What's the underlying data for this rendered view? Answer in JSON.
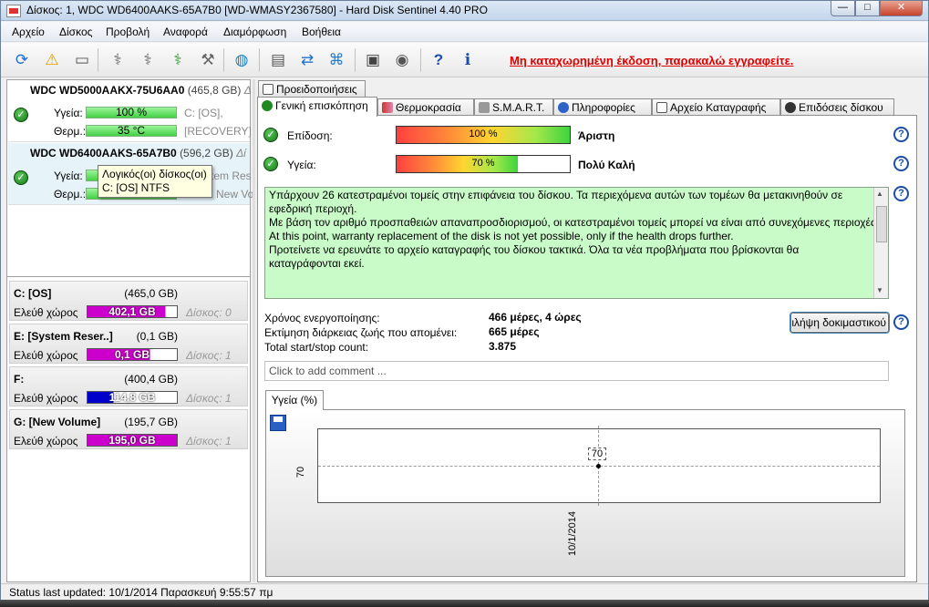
{
  "window": {
    "title": "Δίσκος: 1, WDC WD6400AAKS-65A7B0 [WD-WMASY2367580]  -  Hard Disk Sentinel 4.40 PRO",
    "min": "—",
    "max": "□",
    "close": "✕"
  },
  "menu": [
    "Αρχείο",
    "Δίσκος",
    "Προβολή",
    "Αναφορά",
    "Διαμόρφωση",
    "Βοήθεια"
  ],
  "toolbar": {
    "registration_notice": "Μη καταχωρημένη έκδοση, παρακαλώ εγγραφείτε."
  },
  "disks": [
    {
      "name": "WDC WD5000AAKX-75U6AA0",
      "size": "(465,8 GB)",
      "extra": "Δ",
      "health_label": "Υγεία:",
      "health_value": "100 %",
      "health_part": "C: [OS],",
      "temp_label": "Θερμ.:",
      "temp_value": "35 °C",
      "temp_part": "[RECOVERY]"
    },
    {
      "name": "WDC WD6400AAKS-65A7B0",
      "size": "(596,2 GB)",
      "extra": "Δί",
      "health_label": "Υγεία:",
      "health_value": "",
      "health_part": "tem Res",
      "temp_label": "Θερμ.:",
      "temp_value": "",
      "temp_part": "New Vo"
    }
  ],
  "tooltip": {
    "line1": "Λογικός(οι) δίσκος(οι)",
    "line2": "C: [OS] NTFS"
  },
  "volumes": [
    {
      "name": "C: [OS]",
      "size": "(465,0 GB)",
      "free_label": "Ελεύθ χώρος",
      "free": "402,1 GB",
      "free_fraction": 0.865,
      "disk": "Δίσκος: 0",
      "color": "#cc00cc"
    },
    {
      "name": "E: [System Reser..]",
      "size": "(0,1 GB)",
      "free_label": "Ελεύθ χώρος",
      "free": "0,1 GB",
      "free_fraction": 0.7,
      "disk": "Δίσκος: 1",
      "color": "#cc00cc"
    },
    {
      "name": "F:",
      "size": "(400,4 GB)",
      "free_label": "Ελεύθ χώρος",
      "free": "114,8 GB",
      "free_fraction": 0.287,
      "disk": "Δίσκος: 1",
      "color": "#0000cc"
    },
    {
      "name": "G: [New Volume]",
      "size": "(195,7 GB)",
      "free_label": "Ελεύθ χώρος",
      "free": "195,0 GB",
      "free_fraction": 0.996,
      "disk": "Δίσκος: 1",
      "color": "#cc00cc"
    }
  ],
  "tabs_row1": [
    {
      "label": "Προειδοποιήσεις"
    }
  ],
  "tabs_row2": [
    {
      "label": "Γενική επισκόπηση"
    },
    {
      "label": "Θερμοκρασία"
    },
    {
      "label": "S.M.A.R.T."
    },
    {
      "label": "Πληροφορίες"
    },
    {
      "label": "Αρχείο Καταγραφής"
    },
    {
      "label": "Επιδόσεις δίσκου"
    }
  ],
  "overview": {
    "performance": {
      "label": "Επίδοση:",
      "value": "100 %",
      "fraction": 1.0,
      "rating": "Άριστη"
    },
    "health": {
      "label": "Υγεία:",
      "value": "70 %",
      "fraction": 0.7,
      "rating": "Πολύ Καλή"
    },
    "message": [
      "Υπάρχουν 26 κατεστραμένοι τομείς στην επιφάνεια του δίσκου. Τα περιεχόμενα αυτών των τομέων θα μετακινηθούν σε εφεδρική περιοχή.",
      "Με βάση τον αριθμό προσπαθειών απαναπροσδιορισμού, οι κατεστραμένοι τομείς μπορεί να είναι από συνεχόμενες περιοχές.",
      "At this point, warranty replacement of the disk is not yet possible, only if the health drops further.",
      "Προτείνετε να ερευνάτε το αρχείο καταγραφής του δίσκου τακτικά. Όλα τα νέα προβλήματα που βρίσκονται θα καταγράφονται εκεί."
    ],
    "stats": [
      {
        "label": "Χρόνος ενεργοποίησης:",
        "value": "466 μέρες, 4 ώρες"
      },
      {
        "label": "Εκτίμηση διάρκειας ζωής που απομένει:",
        "value": "665 μέρες"
      },
      {
        "label": "Total start/stop count:",
        "value": "3.875"
      }
    ],
    "test_button": "ιλήψη δοκιμαστικού",
    "comment_placeholder": "Click to add comment ...",
    "help": "?"
  },
  "graph_tab": "Υγεία (%)",
  "chart_data": {
    "type": "line",
    "x": [
      "10/1/2014"
    ],
    "series": [
      {
        "values": [
          70
        ]
      }
    ],
    "data_labels": [
      "70"
    ],
    "ytick": "70",
    "grid": true
  },
  "status": {
    "text": "Status last updated: 10/1/2014 Παρασκευή 9:55:57 πμ"
  }
}
